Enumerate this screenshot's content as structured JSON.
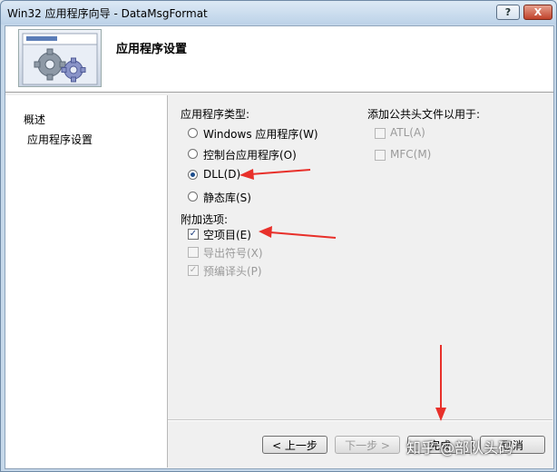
{
  "window": {
    "title": "Win32 应用程序向导 - DataMsgFormat",
    "help_label": "?",
    "close_label": "X"
  },
  "header": {
    "title": "应用程序设置"
  },
  "nav": {
    "items": [
      {
        "label": "概述"
      },
      {
        "label": "应用程序设置"
      }
    ]
  },
  "app_type": {
    "heading": "应用程序类型:",
    "options": [
      {
        "label": "Windows 应用程序(W)",
        "selected": false
      },
      {
        "label": "控制台应用程序(O)",
        "selected": false
      },
      {
        "label": "DLL(D)",
        "selected": true
      },
      {
        "label": "静态库(S)",
        "selected": false
      }
    ]
  },
  "extra_options": {
    "heading": "附加选项:",
    "options": [
      {
        "label": "空项目(E)",
        "checked": true,
        "enabled": true
      },
      {
        "label": "导出符号(X)",
        "checked": false,
        "enabled": false
      },
      {
        "label": "预编译头(P)",
        "checked": true,
        "enabled": false
      }
    ]
  },
  "common_headers": {
    "heading": "添加公共头文件以用于:",
    "options": [
      {
        "label": "ATL(A)",
        "checked": false,
        "enabled": false
      },
      {
        "label": "MFC(M)",
        "checked": false,
        "enabled": false
      }
    ]
  },
  "buttons": {
    "prev": "< 上一步",
    "next": "下一步 >",
    "finish": "完成",
    "cancel": "取消"
  },
  "watermark": "知乎 @部队头码",
  "colors": {
    "annotation_arrow": "#e8302a",
    "selected_radio": "#1d4d8c"
  }
}
